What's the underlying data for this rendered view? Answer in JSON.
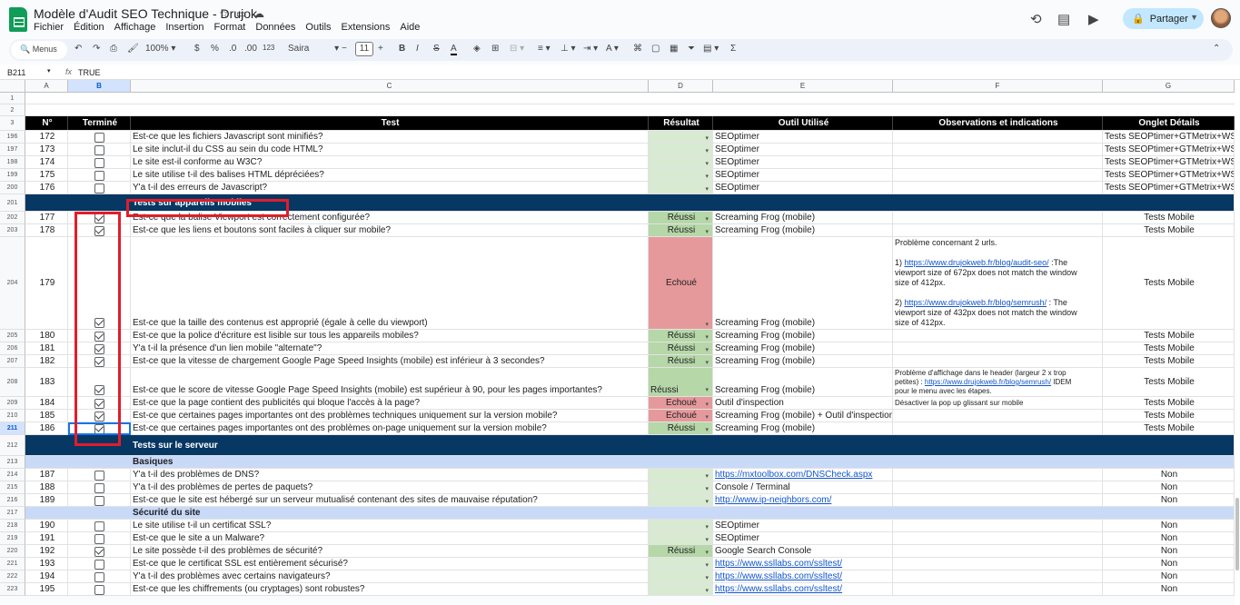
{
  "doc": {
    "title": "Modèle d'Audit SEO Technique - Drujok"
  },
  "menu": [
    "Fichier",
    "Édition",
    "Affichage",
    "Insertion",
    "Format",
    "Données",
    "Outils",
    "Extensions",
    "Aide"
  ],
  "share_label": "Partager",
  "toolbar": {
    "search": "Menus",
    "zoom": "100%",
    "currency": "$",
    "percent": "%",
    "dec_minus": ".0",
    "dec_plus": ".00",
    "format123": "123",
    "font": "Saira",
    "font_size": "11",
    "bold": "B",
    "italic": "I",
    "strike": "S",
    "textcolor": "A",
    "sigma": "Σ"
  },
  "formula": {
    "ref": "B211",
    "fx": "fx",
    "value": "TRUE"
  },
  "columns": [
    "A",
    "B",
    "C",
    "D",
    "E",
    "F",
    "G"
  ],
  "header": {
    "n": "N°",
    "done": "Terminé",
    "test": "Test",
    "result": "Résultat",
    "tool": "Outil Utilisé",
    "obs": "Observations et indications",
    "tab": "Onglet Détails"
  },
  "rows": [
    {
      "r": "196",
      "n": "172",
      "c": false,
      "t": "Est-ce que les fichiers Javascript sont minifiés?",
      "res": "",
      "tool": "SEOptimer",
      "obs": "",
      "tab": "Tests SEOPtimer+GTMetrix+WST"
    },
    {
      "r": "197",
      "n": "173",
      "c": false,
      "t": "Le site inclut-il du CSS au sein du code HTML?",
      "res": "",
      "tool": "SEOptimer",
      "obs": "",
      "tab": "Tests SEOPtimer+GTMetrix+WST"
    },
    {
      "r": "198",
      "n": "174",
      "c": false,
      "t": "Le site est-il conforme au W3C?",
      "res": "",
      "tool": "SEOptimer",
      "obs": "",
      "tab": "Tests SEOPtimer+GTMetrix+WST"
    },
    {
      "r": "199",
      "n": "175",
      "c": false,
      "t": "Le site utilise t-il des balises HTML dépréciées?",
      "res": "",
      "tool": "SEOptimer",
      "obs": "",
      "tab": "Tests SEOPtimer+GTMetrix+WST"
    },
    {
      "r": "200",
      "n": "176",
      "c": false,
      "t": "Y'a t-il des erreurs de Javascript?",
      "res": "",
      "tool": "SEOptimer",
      "obs": "",
      "tab": "Tests SEOPtimer+GTMetrix+WST"
    }
  ],
  "section_mobile": {
    "r": "201",
    "label": "Tests sur appareils mobiles"
  },
  "mobile_rows": [
    {
      "r": "202",
      "n": "177",
      "t": "Est-ce que la balise Viewport est correctement configurée?",
      "res": "Réussi",
      "tool": "Screaming Frog (mobile)",
      "tab": "Tests Mobile"
    },
    {
      "r": "203",
      "n": "178",
      "t": "Est-ce que les liens et boutons sont faciles à cliquer sur mobile?",
      "res": "Réussi",
      "tool": "Screaming Frog (mobile)",
      "tab": "Tests Mobile"
    }
  ],
  "row204": {
    "r": "204",
    "n": "179",
    "t": "Est-ce que la taille des contenus est approprié (égale à celle du viewport)",
    "res": "Echoué",
    "tool": "Screaming Frog (mobile)",
    "tab": "Tests Mobile",
    "obs1": "Problème concernant 2 urls.",
    "obs2a": "1) ",
    "obs2link": "https://www.drujokweb.fr/blog/audit-seo/",
    "obs2b": " :The",
    "obs3": "viewport size of 672px does not match the window",
    "obs4": "size of 412px.",
    "obs5a": "2) ",
    "obs5link": "https://www.drujokweb.fr/blog/semrush/",
    "obs5b": " : The",
    "obs6": "viewport size of 432px does not match the window",
    "obs7": "size of 412px."
  },
  "mobile_rows2": [
    {
      "r": "205",
      "n": "180",
      "t": "Est-ce que la police d'écriture est lisible sur tous les appareils mobiles?",
      "res": "Réussi",
      "tool": "Screaming Frog (mobile)",
      "tab": "Tests Mobile"
    },
    {
      "r": "206",
      "n": "181",
      "t": "Y'a t-il la présence d'un lien mobile \"alternate\"?",
      "res": "Réussi",
      "tool": "Screaming Frog (mobile)",
      "tab": "Tests Mobile"
    },
    {
      "r": "207",
      "n": "182",
      "t": "Est-ce que la vitesse de chargement Google Page Speed Insights (mobile) est inférieur à 3 secondes?",
      "res": "Réussi",
      "tool": "Screaming Frog (mobile)",
      "tab": "Tests Mobile"
    }
  ],
  "row208": {
    "r": "208",
    "n": "183",
    "t": "Est-ce que le score de vitesse Google Page Speed Insights (mobile) est supérieur à 90, pour les pages importantes?",
    "res": "Réussi",
    "tool": "Screaming Frog (mobile)",
    "tab": "Tests Mobile",
    "obs1": "Problème d'affichage dans le header (largeur 2 x trop",
    "obs2a": "petites) : ",
    "obs2link": "https://www.drujokweb.fr/blog/semrush/",
    "obs2b": " IDEM",
    "obs3": "pour le menu avec les étapes."
  },
  "mobile_rows3": [
    {
      "r": "209",
      "n": "184",
      "t": "Est-ce que la page contient des publicités qui bloque l'accès à la page?",
      "res": "Echoué",
      "tool": "Outil d'inspection",
      "obs": "Désactiver la pop up glissant sur mobile",
      "tab": "Tests Mobile"
    },
    {
      "r": "210",
      "n": "185",
      "t": "Est-ce que certaines pages importantes ont des problèmes techniques uniquement sur la version mobile?",
      "res": "Echoué",
      "tool": "Screaming Frog (mobile) + Outil d'inspection",
      "obs": "",
      "tab": "Tests Mobile"
    },
    {
      "r": "211",
      "n": "186",
      "t": "Est-ce que certaines pages importantes ont des problèmes on-page uniquement sur la version mobile?",
      "res": "Réussi",
      "tool": "Screaming Frog (mobile)",
      "obs": "",
      "tab": "Tests Mobile"
    }
  ],
  "section_server": {
    "r": "212",
    "label": "Tests sur le serveur"
  },
  "sub_basiques": {
    "r": "213",
    "label": "Basiques"
  },
  "server_rows": [
    {
      "r": "214",
      "n": "187",
      "c": false,
      "t": "Y'a t-il des problèmes de DNS?",
      "res": "",
      "tool": "https://mxtoolbox.com/DNSCheck.aspx",
      "link": true,
      "tab": "Non"
    },
    {
      "r": "215",
      "n": "188",
      "c": false,
      "t": "Y'a t-il des problèmes de pertes de paquets?",
      "res": "",
      "tool": "Console / Terminal",
      "link": false,
      "tab": "Non"
    },
    {
      "r": "216",
      "n": "189",
      "c": false,
      "t": "Est-ce que le site est hébergé sur un serveur mutualisé contenant des sites de mauvaise réputation?",
      "res": "",
      "tool": "http://www.ip-neighbors.com/",
      "link": true,
      "tab": "Non"
    }
  ],
  "sub_secu": {
    "r": "217",
    "label": "Sécurité du site"
  },
  "secu_rows": [
    {
      "r": "218",
      "n": "190",
      "c": false,
      "t": "Le site utilise t-il un certificat SSL?",
      "res": "",
      "tool": "SEOptimer",
      "link": false,
      "tab": "Non"
    },
    {
      "r": "219",
      "n": "191",
      "c": false,
      "t": "Est-ce que le site a un Malware?",
      "res": "",
      "tool": "SEOptimer",
      "link": false,
      "tab": "Non"
    },
    {
      "r": "220",
      "n": "192",
      "c": true,
      "t": "Le site possède t-il des problèmes de sécurité?",
      "res": "Réussi",
      "tool": "Google Search Console",
      "link": false,
      "tab": "Non"
    },
    {
      "r": "221",
      "n": "193",
      "c": false,
      "t": "Est-ce que le certificat SSL est entièrement sécurisé?",
      "res": "",
      "tool": "https://www.ssllabs.com/ssltest/",
      "link": true,
      "tab": "Non"
    },
    {
      "r": "222",
      "n": "194",
      "c": false,
      "t": "Y'a t-il des problèmes avec certains navigateurs?",
      "res": "",
      "tool": "https://www.ssllabs.com/ssltest/",
      "link": true,
      "tab": "Non"
    },
    {
      "r": "223",
      "n": "195",
      "c": false,
      "t": "Est-ce que les chiffrements (ou cryptages) sont robustes?",
      "res": "",
      "tool": "https://www.ssllabs.com/ssltest/",
      "link": true,
      "tab": "Non"
    }
  ],
  "top_rows": [
    "1",
    "2"
  ],
  "header_row": "3"
}
